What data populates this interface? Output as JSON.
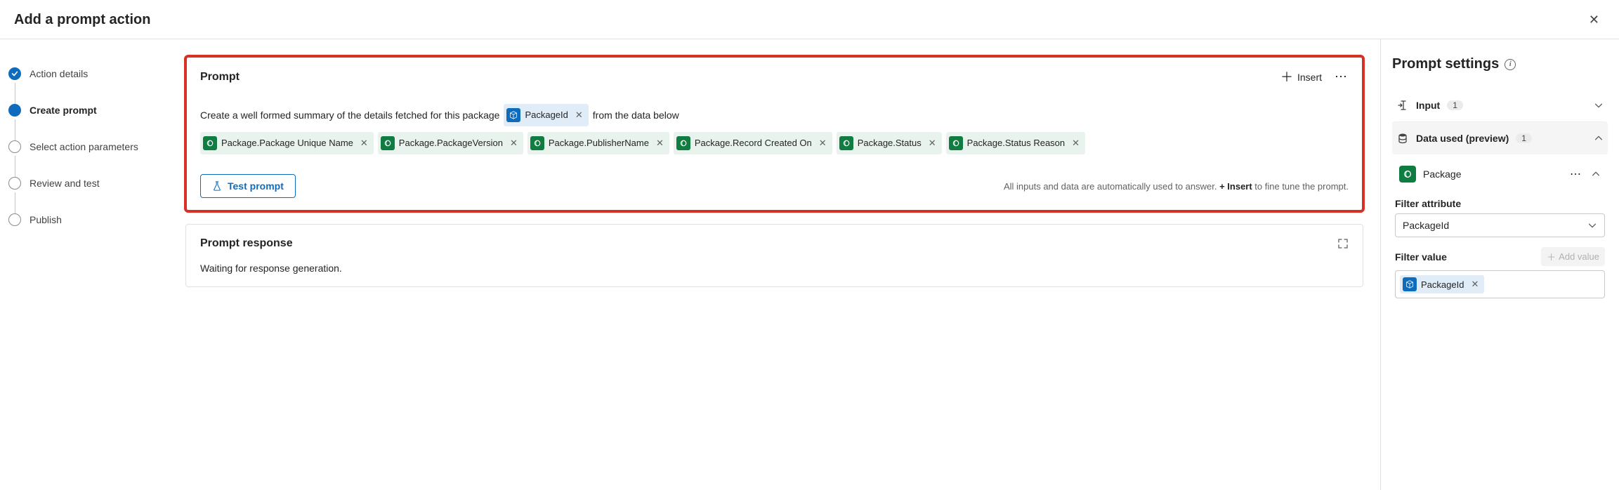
{
  "header": {
    "title": "Add a prompt action"
  },
  "steps": [
    {
      "label": "Action details",
      "state": "done"
    },
    {
      "label": "Create prompt",
      "state": "active"
    },
    {
      "label": "Select action parameters",
      "state": "pending"
    },
    {
      "label": "Review and test",
      "state": "pending"
    },
    {
      "label": "Publish",
      "state": "pending"
    }
  ],
  "prompt_card": {
    "title": "Prompt",
    "insert_label": "Insert",
    "text_before": "Create a well formed summary of the details fetched for this package",
    "inline_token": "PackageId",
    "text_after": "from the data below",
    "tokens": [
      "Package.Package Unique Name",
      "Package.PackageVersion",
      "Package.PublisherName",
      "Package.Record Created On",
      "Package.Status",
      "Package.Status Reason"
    ],
    "test_label": "Test prompt",
    "hint_before": "All inputs and data are automatically used to answer. ",
    "hint_bold": "+ Insert",
    "hint_after": " to fine tune the prompt."
  },
  "response_card": {
    "title": "Prompt response",
    "body": "Waiting for response generation."
  },
  "settings": {
    "title": "Prompt settings",
    "input_section": {
      "label": "Input",
      "count": "1"
    },
    "data_section": {
      "label": "Data used (preview)",
      "count": "1",
      "package_label": "Package",
      "filter_attr_label": "Filter attribute",
      "filter_attr_value": "PackageId",
      "filter_value_label": "Filter value",
      "add_value_label": "Add value",
      "filter_value_token": "PackageId"
    }
  }
}
